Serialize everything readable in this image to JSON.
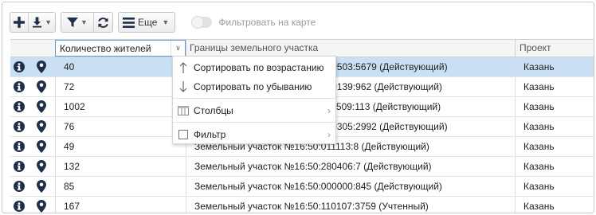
{
  "toolbar": {
    "add_icon": "plus-icon",
    "download_icon": "download-icon",
    "filter_icon": "filter-icon",
    "refresh_icon": "refresh-icon",
    "menu_icon": "hamburger-icon",
    "more_label": "Еще",
    "map_filter_label": "Фильтровать на карте",
    "map_filter_enabled": false
  },
  "grid": {
    "columns": {
      "count": "Количество жителей",
      "boundaries": "Границы земельного участка",
      "project": "Проект"
    },
    "rows": [
      {
        "count": "40",
        "boundary": "Земельный участок №16:50:080503:5679 (Действующий)",
        "project": "Казань",
        "selected": true
      },
      {
        "count": "72",
        "boundary": "Земельный участок №16:50:150139:962 (Действующий)",
        "project": "Казань"
      },
      {
        "count": "1002",
        "boundary": "Земельный участок №16:50:110509:113 (Действующий)",
        "project": "Казань"
      },
      {
        "count": "76",
        "boundary": "Земельный участок №16:50:050305:2992 (Действующий)",
        "project": "Казань"
      },
      {
        "count": "49",
        "boundary": "Земельный участок №16:50:011113:8 (Действующий)",
        "project": "Казань"
      },
      {
        "count": "132",
        "boundary": "Земельный участок №16:50:280406:7 (Действующий)",
        "project": "Казань"
      },
      {
        "count": "85",
        "boundary": "Земельный участок №16:50:000000:845 (Действующий)",
        "project": "Казань"
      },
      {
        "count": "167",
        "boundary": "Земельный участок №16:50:110107:3759 (Учтенный)",
        "project": "Казань"
      }
    ]
  },
  "column_menu": {
    "sort_asc": "Сортировать по возрастанию",
    "sort_desc": "Сортировать по убыванию",
    "columns": "Столбцы",
    "filter": "Фильтр"
  }
}
